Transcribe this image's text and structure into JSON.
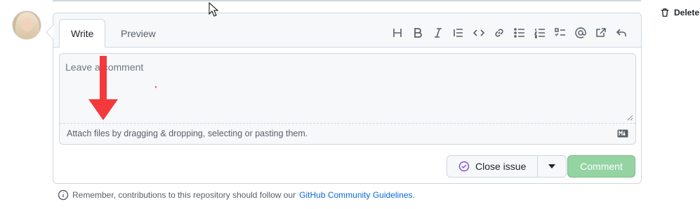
{
  "header": {
    "delete_label": "Delete i"
  },
  "tabs": [
    {
      "label": "Write"
    },
    {
      "label": "Preview"
    }
  ],
  "toolbar": {
    "icons": [
      "heading-icon",
      "bold-icon",
      "italic-icon",
      "quote-icon",
      "code-icon",
      "link-icon",
      "unordered-list-icon",
      "ordered-list-icon",
      "task-list-icon",
      "mention-icon",
      "reference-icon",
      "reply-icon"
    ]
  },
  "editor": {
    "placeholder": "Leave a comment",
    "attach_hint": "Attach files by dragging & dropping, selecting or pasting them."
  },
  "actions": {
    "close_label": "Close issue",
    "comment_label": "Comment"
  },
  "footer": {
    "note_prefix": "Remember, contributions to this repository should follow our ",
    "link_text": "GitHub Community Guidelines",
    "note_suffix": "."
  },
  "colors": {
    "accent_link": "#0969da",
    "comment_button": "#94d3a2",
    "close_icon": "#8250df",
    "annotation_arrow": "#f4393c"
  }
}
